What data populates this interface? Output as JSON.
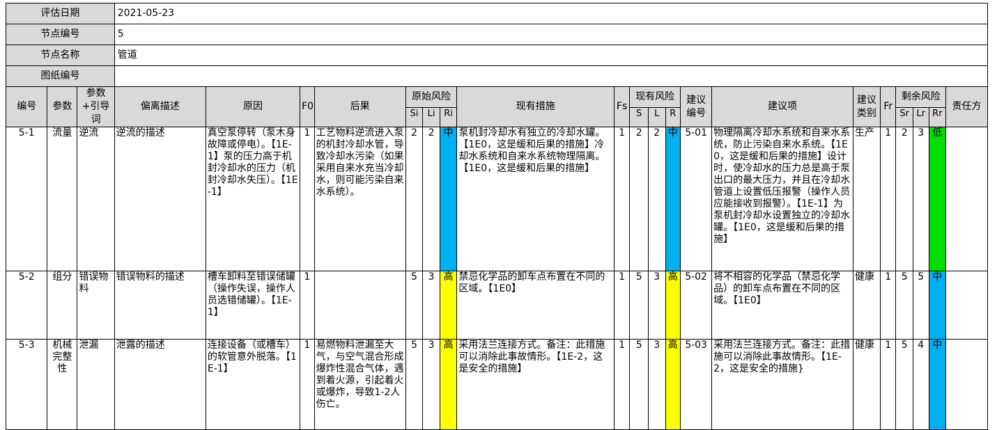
{
  "info": {
    "date_label": "评估日期",
    "date_value": "2021-05-23",
    "node_no_label": "节点编号",
    "node_no_value": "5",
    "node_name_label": "节点名称",
    "node_name_value": "管道",
    "drawing_label": "图纸编号",
    "drawing_value": ""
  },
  "headers": {
    "no": "编号",
    "param": "参数",
    "guide": "参数+引导词",
    "dev": "偏离描述",
    "cause": "原因",
    "f0": "F0",
    "conseq": "后果",
    "orig_risk": "原始风险",
    "si": "Si",
    "li": "Li",
    "ri": "Ri",
    "measures": "现有措施",
    "fs": "Fs",
    "cur_risk": "现有风险",
    "s": "S",
    "l": "L",
    "r": "R",
    "rec_no": "建议编号",
    "rec": "建议项",
    "rec_type": "建议类别",
    "fr": "Fr",
    "res_risk": "剩余风险",
    "sr": "Sr",
    "lr": "Lr",
    "rr": "Rr",
    "owner": "责任方"
  },
  "colors": {
    "blue": "#00b0f0",
    "yellow": "#ffff00",
    "green": "#00e000",
    "header_gray": "#d9d9d9"
  },
  "rows": [
    {
      "no": "5-1",
      "param": "流量",
      "guide": "逆流",
      "dev": "逆流的描述",
      "cause": "真空泵停转（泵木身故障或停电）。【1E-1】泵的压力高于机封冷却水的压力（机封冷却水失压）。【1E-1】",
      "f0": "1",
      "conseq": "工艺物料逆流进入泵的机封冷却水管，导致冷却水污染（如果采用自来水充当冷却水，则可能污染自来水系统）。",
      "si": "2",
      "li": "2",
      "ri": "中",
      "ri_color": "blue",
      "measures": "泵机封冷却水有独立的冷却水罐。【1E0，这是缓和后果的措施】冷却水系统和自来水系统物理隔离。【1E0，这是缓和后果的措施】",
      "fs": "1",
      "s": "2",
      "l": "2",
      "r": "中",
      "r_color": "blue",
      "rec_no": "5-01",
      "rec": "物理隔离冷却水系统和自来水系统，防止污染自来水系统。【1E0，这是缓和后果的措施】设计时，使冷却水的压力总是高于泵出口的最大压力，并且在冷却水管道上设置低压报警（操作人员应能接收到报警）。【1E-1】为泵机封冷却水设置独立的冷却水罐。【1E0，这是缓和后果的措施】",
      "rec_type": "生产",
      "fr": "1",
      "sr": "2",
      "lr": "3",
      "rr": "低",
      "rr_color": "green",
      "owner": ""
    },
    {
      "no": "5-2",
      "param": "组分",
      "guide": "错误物料",
      "dev": "错误物料的描述",
      "cause": "槽车卸料至错误储罐（操作失误，操作人员选错储罐）。【1E-1】",
      "f0": "1",
      "conseq": "",
      "si": "5",
      "li": "3",
      "ri": "高",
      "ri_color": "yellow",
      "measures": "禁忌化学品的卸车点布置在不同的区域。【1E0】",
      "fs": "1",
      "s": "5",
      "l": "3",
      "r": "高",
      "r_color": "yellow",
      "rec_no": "5-02",
      "rec": "将不相容的化学品（禁忌化学品）的卸车点布置在不同的区域。【1E0】",
      "rec_type": "健康",
      "fr": "1",
      "sr": "5",
      "lr": "5",
      "rr": "中",
      "rr_color": "blue",
      "owner": ""
    },
    {
      "no": "5-3",
      "param": "机械完整性",
      "guide": "泄漏",
      "dev": "泄露的描述",
      "cause": "连接设备（或槽车）的软管意外脱落。【1E-1】",
      "f0": "1",
      "conseq": "易燃物料泄漏至大气，与空气混合形成爆炸性混合气体，遇到着火源，引起着火或爆炸，导致1-2人伤亡。",
      "si": "5",
      "li": "3",
      "ri": "高",
      "ri_color": "yellow",
      "measures": "采用法兰连接方式。备注：此措施可以消除此事故情形。【1E-2，这是安全的措施】",
      "fs": "1",
      "s": "5",
      "l": "3",
      "r": "高",
      "r_color": "yellow",
      "rec_no": "5-03",
      "rec": "采用法兰连接方式。备注：此措施可以消除此事故情形。【1E-2，这是安全的措施}",
      "rec_type": "健康",
      "fr": "1",
      "sr": "5",
      "lr": "4",
      "rr": "中",
      "rr_color": "blue",
      "owner": ""
    }
  ]
}
